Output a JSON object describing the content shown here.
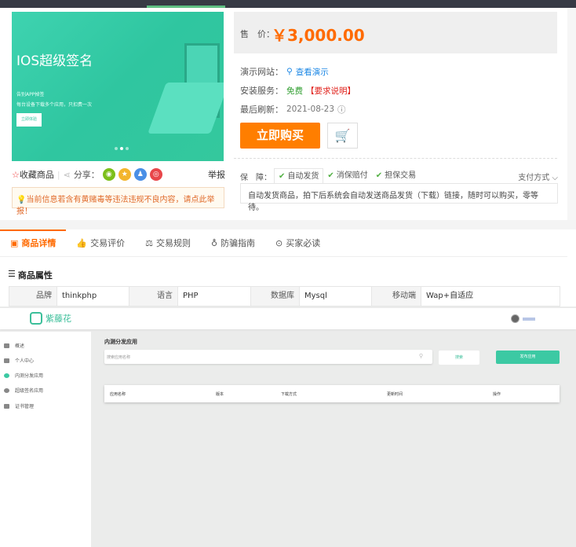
{
  "banner": {
    "title": "IOS超级签名",
    "line1": "告别APP掉签",
    "line2": "每台设备下载多个应用，只扣费一次",
    "button": "立即体验"
  },
  "price": {
    "label": "售　价：",
    "value": "￥3,000.00"
  },
  "info": {
    "demo_label": "演示网站：",
    "demo_link": "查看演示",
    "install_label": "安装服务：",
    "install_value": "免费",
    "install_note": "【要求说明】",
    "refresh_label": "最后刷新：",
    "refresh_value": "2021-08-23"
  },
  "buy_label": "立即购买",
  "guarantee": {
    "label": "保　障：",
    "tabs": [
      "自动发货",
      "消保赔付",
      "担保交易"
    ],
    "pay": "支付方式",
    "desc": "自动发货商品，拍下后系统会自动发送商品发货（下载）链接，随时可以购买，零等待。"
  },
  "actions": {
    "favorite": "收藏商品",
    "share": "分享：",
    "report": "举报"
  },
  "notice": "当前信息若含有黄赌毒等违法违规不良内容，请点此举报！",
  "tabs": [
    "商品详情",
    "交易评价",
    "交易规则",
    "防骗指南",
    "买家必读"
  ],
  "attributes": {
    "title": "商品属性",
    "items": [
      {
        "k": "品牌",
        "v": "thinkphp"
      },
      {
        "k": "语言",
        "v": "PHP"
      },
      {
        "k": "数据库",
        "v": "Mysql"
      },
      {
        "k": "移动端",
        "v": "Wap+自适应"
      }
    ]
  },
  "embedded": {
    "logo": "紫藤花",
    "sidebar": [
      "概述",
      "个人中心",
      "内测分发应用",
      "超级签名应用",
      "证书管理"
    ],
    "title": "内测分发应用",
    "search_placeholder": "搜索应用名称",
    "search_button": "搜索",
    "publish_button": "发布应用",
    "columns": [
      "应用名称",
      "版本",
      "下载方式",
      "更新时间",
      "操作"
    ]
  },
  "colors": {
    "accent": "#ff7e00",
    "price": "#ff6a00",
    "teal": "#3cc9a3"
  }
}
